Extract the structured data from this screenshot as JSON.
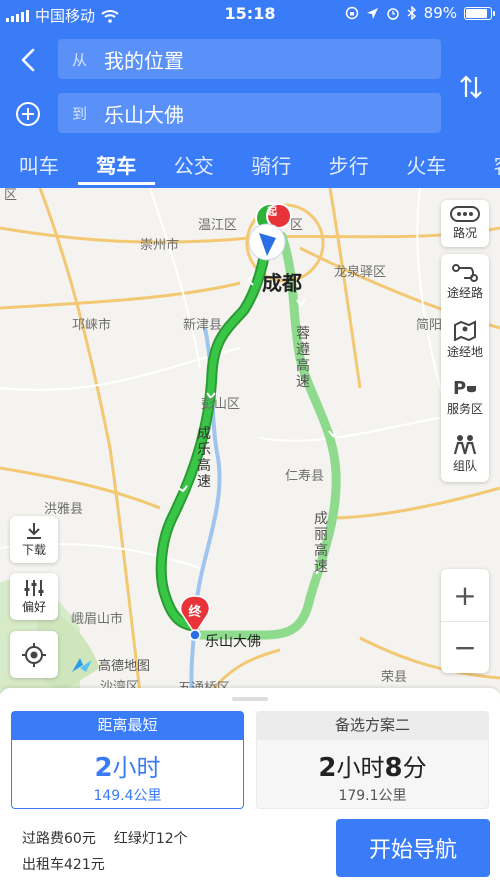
{
  "status_bar": {
    "carrier": "中国移动",
    "time": "15:18",
    "battery": "89%",
    "battery_level": 0.89
  },
  "route": {
    "from_tag": "从",
    "from_value": "我的位置",
    "to_tag": "到",
    "to_value": "乐山大佛"
  },
  "modes": [
    {
      "label": "叫车",
      "active": false
    },
    {
      "label": "驾车",
      "active": true
    },
    {
      "label": "公交",
      "active": false
    },
    {
      "label": "骑行",
      "active": false
    },
    {
      "label": "步行",
      "active": false
    },
    {
      "label": "火车",
      "active": false
    },
    {
      "label": "客",
      "active": false
    }
  ],
  "map": {
    "places": {
      "wenjiang": "温江区",
      "chongzhou": "崇州市",
      "longquanyi": "龙泉驿区",
      "qionglai": "邛崃市",
      "xinjin": "新津县",
      "jianyang": "简阳",
      "pengshan": "彭山区",
      "renshou": "仁寿县",
      "hongya": "洪雅县",
      "emeishan": "峨眉山市",
      "shawan": "沙湾区",
      "wutongqiao": "五通桥区",
      "rongxian": "荣县",
      "district_fragment": "区"
    },
    "city": "成都",
    "destination": "乐山大佛",
    "start_marker": "起",
    "end_marker": "终",
    "roads": {
      "main_route": "成乐高速",
      "alt_route_1": "蓉遵高速",
      "alt_route_2": "成丽高速"
    },
    "side_buttons": [
      "路况",
      "途经路",
      "途经地",
      "服务区",
      "组队"
    ],
    "download_label": "下载",
    "preference_label": "偏好",
    "zoom_in": "+",
    "zoom_out": "−",
    "logo_text": "高德地图",
    "colors": {
      "main_route": "#2db239",
      "alt_route": "#8fdb8d",
      "accent": "#3a7cf7",
      "start_marker": "#2db239",
      "end_marker": "#e8333a"
    }
  },
  "plans": [
    {
      "title": "距离最短",
      "hours": "2",
      "hours_unit": "小时",
      "minutes": "",
      "minutes_unit": "",
      "distance": "149.4公里",
      "selected": true
    },
    {
      "title": "备选方案二",
      "hours": "2",
      "hours_unit": "小时",
      "minutes": "8",
      "minutes_unit": "分",
      "distance": "179.1公里",
      "selected": false
    }
  ],
  "trip_info": {
    "toll": "过路费60元",
    "lights": "红绿灯12个",
    "taxi": "出租车421元"
  },
  "start_nav_label": "开始导航"
}
